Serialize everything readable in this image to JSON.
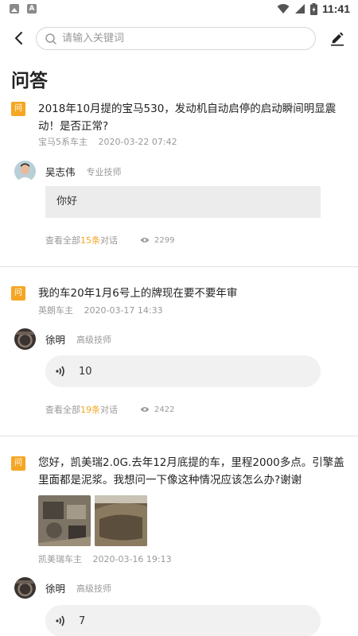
{
  "status_bar": {
    "time": "11:41",
    "left_icons": [
      "photo-icon",
      "a-icon"
    ],
    "right_icons": [
      "wifi-icon",
      "signal-icon",
      "battery-icon"
    ]
  },
  "search": {
    "placeholder": "请输入关键词",
    "value": ""
  },
  "page": {
    "title": "问答"
  },
  "colors": {
    "accent": "#f5a623",
    "meta": "#999999",
    "answer_bg": "#ececec",
    "divider": "#e2e2e2"
  },
  "questions": [
    {
      "badge": "问",
      "text": "2018年10月提的宝马530，发动机自动启停的启动瞬间明显震动！是否正常?",
      "author": "宝马5系车主",
      "time": "2020-03-22 07:42",
      "answer": {
        "name": "吴志伟",
        "title": "专业技师",
        "type": "text",
        "content": "你好"
      },
      "footer": {
        "prefix": "查看全部",
        "count": "15条",
        "suffix": "对话",
        "views": "2299"
      }
    },
    {
      "badge": "问",
      "text": "我的车20年1月6号上的牌现在要不要年审",
      "author": "英朗车主",
      "time": "2020-03-17 14:33",
      "answer": {
        "name": "徐明",
        "title": "高级技师",
        "type": "voice",
        "content": "10"
      },
      "footer": {
        "prefix": "查看全部",
        "count": "19条",
        "suffix": "对话",
        "views": "2422"
      }
    },
    {
      "badge": "问",
      "text": "您好，凯美瑞2.0G.去年12月底提的车，里程2000多点。引擎盖里面都是泥浆。我想问一下像这种情况应该怎么办?谢谢",
      "images": [
        "engine-bay-photo",
        "mud-cover-photo"
      ],
      "author": "凯美瑞车主",
      "time": "2020-03-16 19:13",
      "answer": {
        "name": "徐明",
        "title": "高级技师",
        "type": "voice",
        "content": "7"
      }
    }
  ]
}
